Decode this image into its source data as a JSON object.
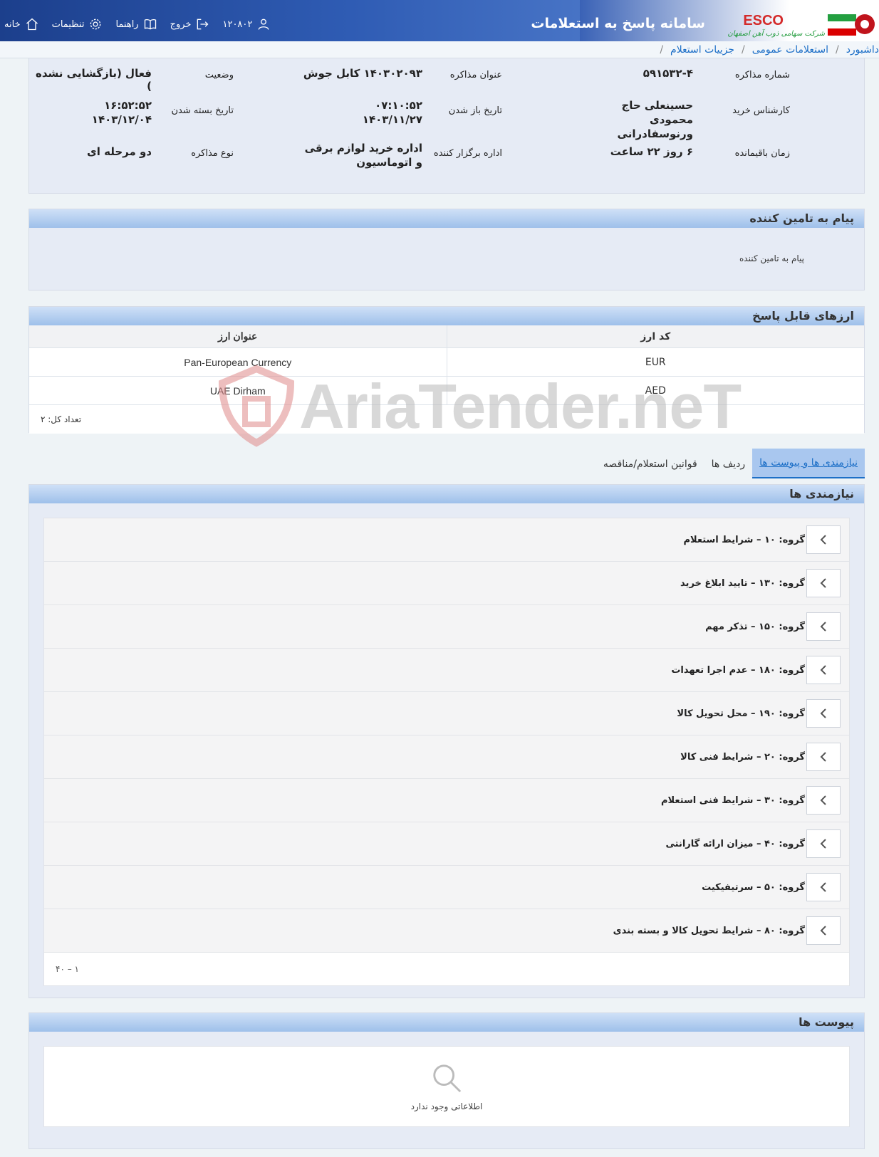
{
  "header": {
    "app_title": "سامانه پاسخ به استعلامات",
    "company_logo": "ESCO",
    "company_subtitle": "شرکت سهامی ذوب آهن اصفهان",
    "nav": [
      {
        "label": "خانه",
        "icon": "home-icon"
      },
      {
        "label": "تنظیمات",
        "icon": "gear-icon"
      },
      {
        "label": "راهنما",
        "icon": "book-icon"
      },
      {
        "label": "خروج",
        "icon": "logout-icon"
      },
      {
        "label": "۱۲۰۸۰۲",
        "icon": "user-icon"
      }
    ]
  },
  "breadcrumb": [
    "داشبورد",
    "استعلامات عمومی",
    "جزییات استعلام"
  ],
  "info": {
    "negotiation_no_label": "شماره مذاکره",
    "negotiation_no": "۵۹۱۵۳۲-۴",
    "negotiation_title_label": "عنوان مذاکره",
    "negotiation_title": "۱۴۰۳۰۲۰۹۳ کابل جوش",
    "status_label": "وضعیت",
    "status": "فعال (بازگشایی نشده )",
    "expert_label": "کارشناس خرید",
    "expert": "حسینعلی حاج محمودی ورنوسفادرانی",
    "open_date_label": "تاریخ باز شدن",
    "open_time": "۰۷:۱۰:۵۲",
    "open_date": "۱۴۰۳/۱۱/۲۷",
    "close_date_label": "تاریخ بسته شدن",
    "close_time": "۱۶:۵۲:۵۲",
    "close_date": "۱۴۰۳/۱۲/۰۴",
    "remaining_label": "زمان باقیمانده",
    "remaining": "۶ روز ۲۲ ساعت",
    "organizer_label": "اداره برگزار کننده",
    "organizer": "اداره خرید لوازم برقی و اتوماسیون",
    "type_label": "نوع مذاکره",
    "type": "دو مرحله ای"
  },
  "message": {
    "title": "پیام به تامین کننده",
    "label": "پیام به تامین کننده"
  },
  "currencies": {
    "title": "ارزهای قابل پاسخ",
    "columns": [
      "کد ارز",
      "عنوان ارز"
    ],
    "rows": [
      {
        "code": "EUR",
        "name": "Pan-European Currency"
      },
      {
        "code": "AED",
        "name": "UAE Dirham"
      }
    ],
    "total": "تعداد کل: ۲"
  },
  "tabs": [
    "نیازمندی ها و پیوست ها",
    "ردیف ها",
    "قوانین استعلام/مناقصه"
  ],
  "needs": {
    "title": "نیازمندی ها",
    "groups": [
      "گروه: ۱۰ – شرایط استعلام",
      "گروه: ۱۳۰ – تایید ابلاغ خرید",
      "گروه: ۱۵۰ – تذکر مهم",
      "گروه: ۱۸۰ – عدم اجرا تعهدات",
      "گروه: ۱۹۰ – محل تحویل کالا",
      "گروه: ۲۰ – شرایط فنی کالا",
      "گروه: ۳۰ – شرایط فنی استعلام",
      "گروه: ۴۰ – میزان ارائه گارانتی",
      "گروه: ۵۰ – سرتیفیکیت",
      "گروه: ۸۰ – شرایط تحویل کالا و بسته بندی"
    ],
    "pager": "۱ – ۴۰"
  },
  "attachments": {
    "title": "پیوست ها",
    "empty": "اطلاعاتی وجود ندارد"
  },
  "watermark": "AriaTender.neT",
  "colors": {
    "accent": "#1d6fc7",
    "header": "#1c3f8c",
    "panel_head": "#9ec0ea"
  }
}
